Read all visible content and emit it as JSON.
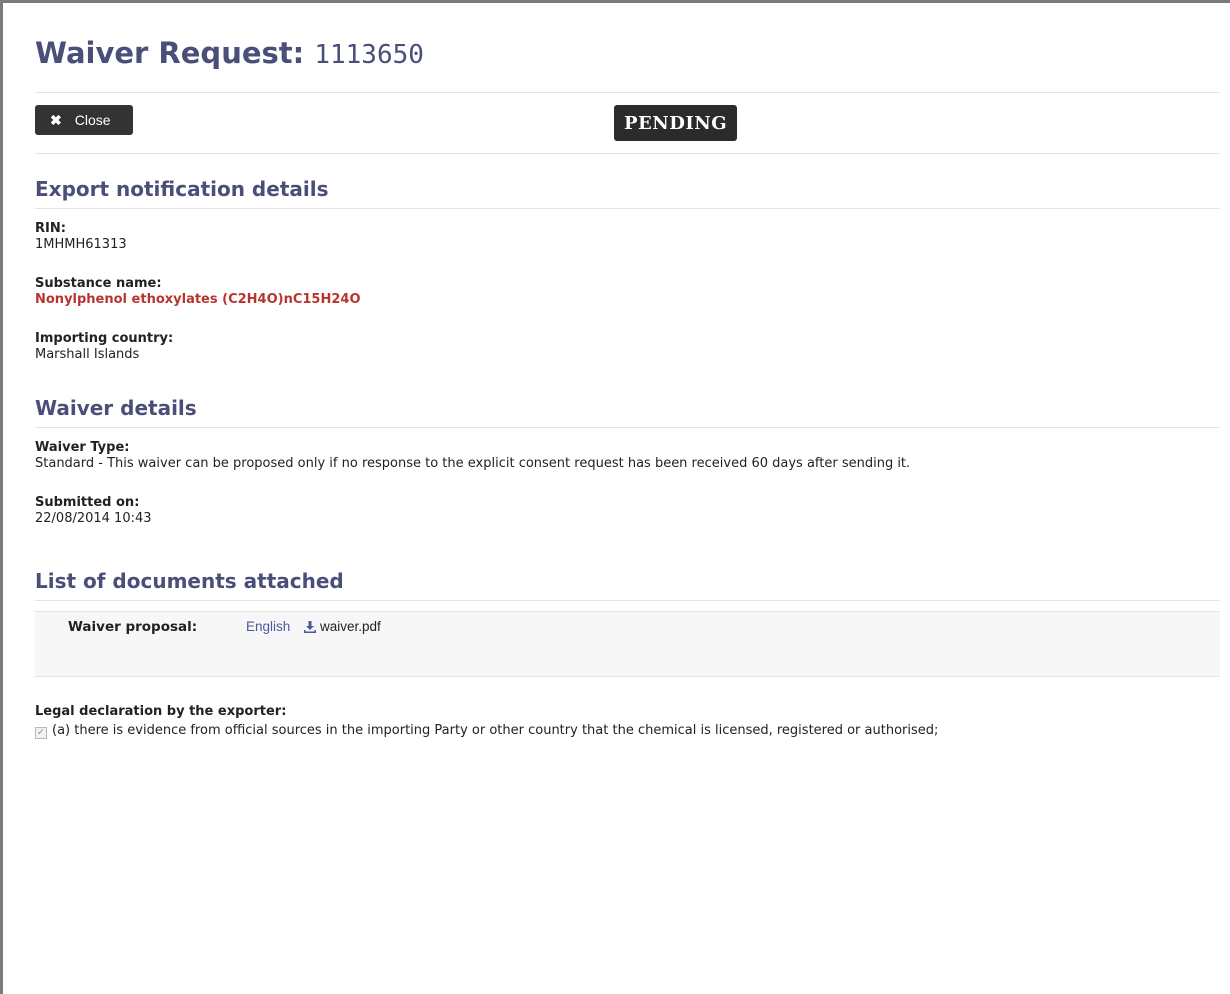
{
  "header": {
    "title": "Waiver Request:",
    "request_number": "1113650"
  },
  "toolbar": {
    "close_label": "Close",
    "close_icon": "close-icon",
    "status": "PENDING"
  },
  "export_notification": {
    "title": "Export notification details",
    "rin_label": "RIN:",
    "rin_value": "1MHMH61313",
    "substance_label": "Substance name:",
    "substance_value": "Nonylphenol ethoxylates (C2H4O)nC15H24O",
    "country_label": "Importing country:",
    "country_value": "Marshall Islands"
  },
  "waiver_details": {
    "title": "Waiver details",
    "type_label": "Waiver Type:",
    "type_value": "Standard - This waiver can be proposed only if no response to the explicit consent request has been received 60 days after sending it.",
    "submitted_label": "Submitted on:",
    "submitted_value": "22/08/2014 10:43"
  },
  "documents": {
    "title": "List of documents attached",
    "items": [
      {
        "label": "Waiver proposal:",
        "language": "English",
        "file_name": "waiver.pdf",
        "icon": "download-icon"
      }
    ]
  },
  "legal": {
    "label": "Legal declaration by the exporter:",
    "declarations": [
      {
        "checked": true,
        "text": "(a) there is evidence from official sources in the importing Party or other country that the chemical is licensed, registered or authorised;"
      }
    ]
  },
  "colors": {
    "heading": "#4a4f7a",
    "substance": "#b8352f",
    "link": "#4a5a9a",
    "badge_bg": "#2b2b2b"
  }
}
